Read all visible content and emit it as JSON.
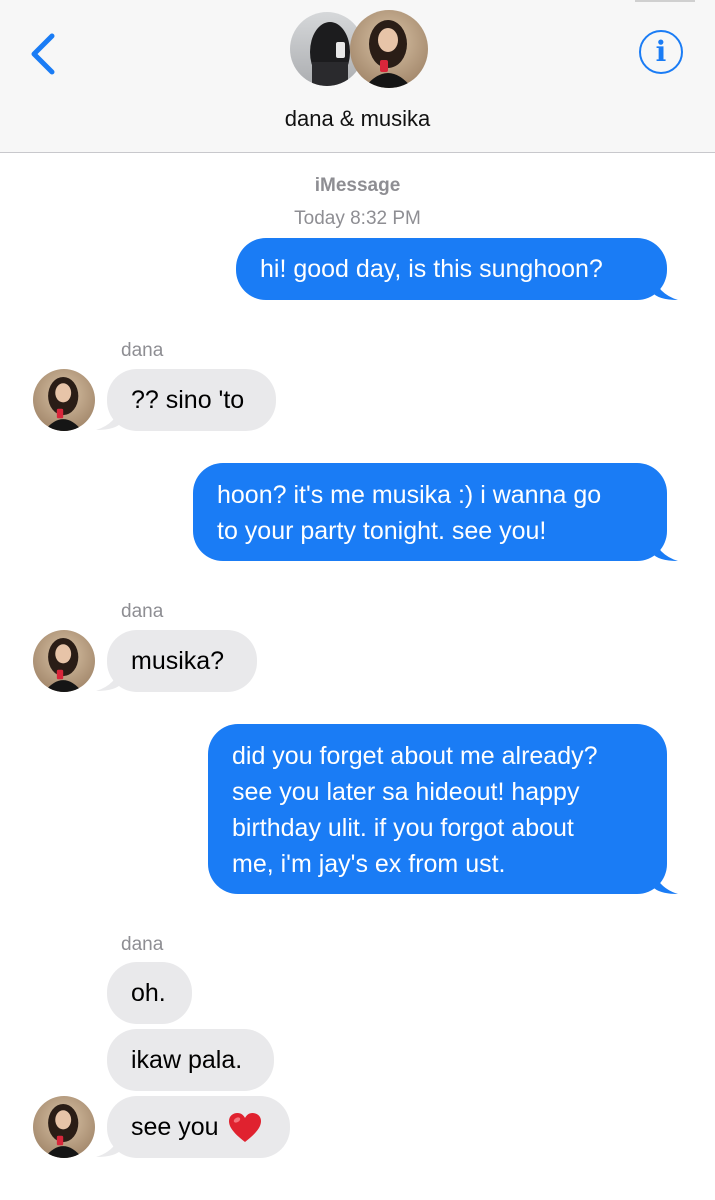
{
  "header": {
    "thread_name": "dana & musika",
    "back_icon": "chevron-left-icon",
    "info_icon": "info-icon",
    "accent": "#1a7cf5"
  },
  "conversation": {
    "service": "iMessage",
    "timestamp": "Today 8:32 PM",
    "messages": [
      {
        "direction": "outgoing",
        "text": "hi! good day, is this sunghoon?"
      },
      {
        "direction": "incoming",
        "sender": "dana",
        "text": "?? sino 'to"
      },
      {
        "direction": "outgoing",
        "lines": [
          "hoon? it's me musika :) i wanna go",
          "to your party tonight. see you!"
        ]
      },
      {
        "direction": "incoming",
        "sender": "dana",
        "text": "musika?"
      },
      {
        "direction": "outgoing",
        "lines": [
          "did you forget about me already?",
          "see you later sa hideout! happy",
          "birthday ulit. if you forgot about",
          "me, i'm jay's ex from ust."
        ]
      },
      {
        "direction": "incoming",
        "sender": "dana",
        "text": "oh."
      },
      {
        "direction": "incoming",
        "text": "ikaw pala."
      },
      {
        "direction": "incoming",
        "text": "see you",
        "emoji": "red-heart-icon"
      }
    ]
  },
  "colors": {
    "outgoing_bubble": "#1a7cf5",
    "incoming_bubble": "#e9e9eb",
    "meta_text": "#8e8e93"
  }
}
